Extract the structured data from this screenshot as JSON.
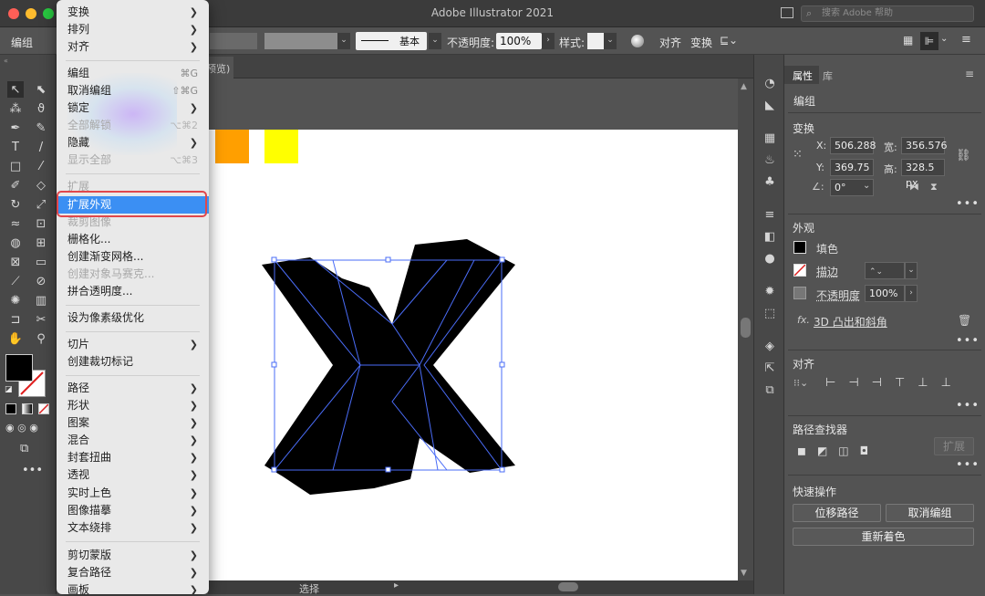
{
  "app": {
    "title": "Adobe Illustrator 2021",
    "search_placeholder": "搜索 Adobe 帮助"
  },
  "control_bar": {
    "selection_label": "编组",
    "stroke_style": "基本",
    "opacity_label": "不透明度:",
    "opacity_value": "100%",
    "style_label": "样式:",
    "align_label": "对齐",
    "transform_label": "变换"
  },
  "doc_tab": {
    "label": "预览)"
  },
  "status_bar": {
    "tool": "选择"
  },
  "menu": {
    "items": [
      {
        "label": "变换",
        "submenu": true
      },
      {
        "label": "排列",
        "submenu": true
      },
      {
        "label": "对齐",
        "submenu": true
      },
      {
        "label": "编组",
        "shortcut": "⌘G"
      },
      {
        "label": "取消编组",
        "shortcut": "⇧⌘G"
      },
      {
        "label": "锁定",
        "submenu": true
      },
      {
        "label": "全部解锁",
        "shortcut": "⌥⌘2",
        "disabled": true
      },
      {
        "label": "隐藏",
        "submenu": true
      },
      {
        "label": "显示全部",
        "shortcut": "⌥⌘3",
        "disabled": true
      },
      {
        "label": "扩展",
        "disabled": true
      },
      {
        "label": "扩展外观",
        "highlighted": true
      },
      {
        "label": "裁剪图像",
        "disabled": true
      },
      {
        "label": "栅格化..."
      },
      {
        "label": "创建渐变网格..."
      },
      {
        "label": "创建对象马赛克...",
        "disabled": true
      },
      {
        "label": "拼合透明度..."
      },
      {
        "label": "设为像素级优化"
      },
      {
        "label": "切片",
        "submenu": true
      },
      {
        "label": "创建裁切标记"
      },
      {
        "label": "路径",
        "submenu": true
      },
      {
        "label": "形状",
        "submenu": true
      },
      {
        "label": "图案",
        "submenu": true
      },
      {
        "label": "混合",
        "submenu": true
      },
      {
        "label": "封套扭曲",
        "submenu": true
      },
      {
        "label": "透视",
        "submenu": true
      },
      {
        "label": "实时上色",
        "submenu": true
      },
      {
        "label": "图像描摹",
        "submenu": true
      },
      {
        "label": "文本绕排",
        "submenu": true
      },
      {
        "label": "剪切蒙版",
        "submenu": true
      },
      {
        "label": "复合路径",
        "submenu": true
      },
      {
        "label": "画板",
        "submenu": true
      }
    ]
  },
  "properties_panel": {
    "tabs": [
      "属性",
      "库"
    ],
    "selection_type": "编组",
    "transform": {
      "title": "变换",
      "x_label": "X:",
      "x_value": "506.288",
      "y_label": "Y:",
      "y_value": "369.75 p",
      "w_label": "宽:",
      "w_value": "356.576",
      "h_label": "高:",
      "h_value": "328.5 px",
      "angle_value": "0°"
    },
    "appearance": {
      "title": "外观",
      "fill_label": "填色",
      "stroke_label": "描边",
      "opacity_label": "不透明度",
      "opacity_value": "100%",
      "effect_label": "3D 凸出和斜角"
    },
    "align": {
      "title": "对齐"
    },
    "pathfinder": {
      "title": "路径查找器",
      "expand_label": "扩展"
    },
    "quick_actions": {
      "title": "快速操作",
      "offset_path": "位移路径",
      "ungroup": "取消编组",
      "recolor": "重新着色"
    }
  },
  "colors": {
    "orange_swatch": "#ff9f00",
    "yellow_swatch": "#ffff00",
    "selection": "#4a6cf7",
    "menu_highlight": "#3b8ff3"
  }
}
